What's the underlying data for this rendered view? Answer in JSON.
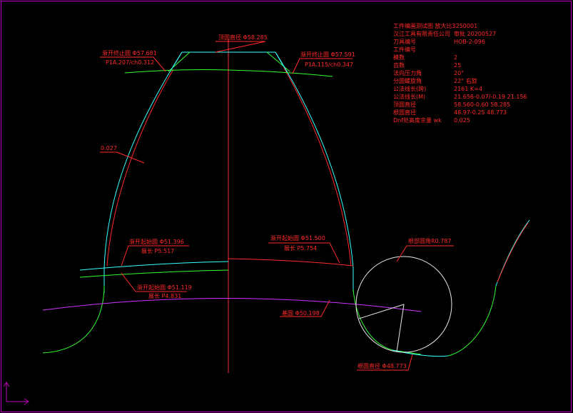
{
  "colors": {
    "background": "#000000",
    "frame": "#c000c0",
    "red": "#ff2a2a",
    "green": "#33ff33",
    "cyan": "#33ffff",
    "magenta": "#cc33ff",
    "white": "#e8e8e8"
  },
  "labels": {
    "tip_diameter": "顶圆直径 Φ58.285",
    "left_finish_circle": "渐开终止圆 Φ57.681",
    "left_finish_param": "P1A.207/ch0.312",
    "right_finish_circle": "渐开终止圆 Φ57.591",
    "right_finish_param": "P1A.115/ch0.347",
    "tolerance": "0.027",
    "left_start_circle": "渐开起始圆 Φ51.396",
    "left_start_length": "展长 P5.517",
    "right_start_circle": "渐开起始圆 Φ51.500",
    "right_start_length": "展长 P5.754",
    "lower_start_circle": "渐开起始圆 Φ51.119",
    "lower_start_length": "展长 P4.831",
    "pitch_circle": "基圆 Φ50.198",
    "root_radius": "根部圆角R0.787",
    "root_diameter": "根圆直径 Φ48.773"
  },
  "info": [
    {
      "label": "工件编画测试图 放大比3250001",
      "value": ""
    },
    {
      "label": "汉江工具有限责任公司",
      "value": "审批 20200527"
    },
    {
      "label": "刀具编号",
      "value": "HOB-2-096"
    },
    {
      "label": "工件编号",
      "value": ""
    },
    {
      "label": "模数",
      "value": "2"
    },
    {
      "label": "齿数",
      "value": "25"
    },
    {
      "label": "法向压力角",
      "value": "20°"
    },
    {
      "label": "分圆螺旋角",
      "value": "22° 右旋"
    },
    {
      "label": "公法线长(跨)",
      "value": "2161 K=4"
    },
    {
      "label": "公法线长(M)",
      "value": "21.656-0.07/-0.19 21.156"
    },
    {
      "label": "顶圆直径",
      "value": "58.560-0.60 58.285"
    },
    {
      "label": "根圆直径",
      "value": "48.97-0.25 48.773"
    },
    {
      "label": "Dnf处高度余量 wk",
      "value": "0.025"
    }
  ]
}
